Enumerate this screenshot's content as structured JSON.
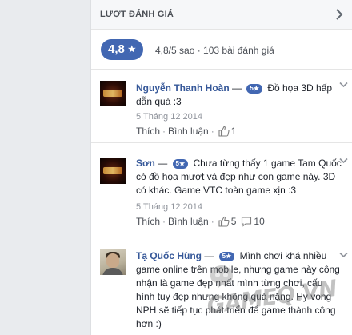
{
  "header": {
    "title": "LƯỢT ĐÁNH GIÁ"
  },
  "summary": {
    "rating": "4,8",
    "rating_text": "4,8/5 sao · 103 bài đánh giá"
  },
  "reviews": [
    {
      "author": "Nguyễn Thanh Hoàn",
      "dash": " — ",
      "stars_badge": "5★",
      "text": "Đồ họa 3D hấp dẫn quá :3",
      "date": "5 Tháng 12 2014",
      "like_label": "Thích",
      "comment_label": "Bình luận",
      "like_count": "1"
    },
    {
      "author": "Sơn",
      "dash": " — ",
      "stars_badge": "5★",
      "text": "Chưa từng thấy 1 game Tam Quốc có đồ họa mượt và đẹp như con game này. 3D có khác. Game VTC toàn game xịn :3",
      "date": "5 Tháng 12 2014",
      "like_label": "Thích",
      "comment_label": "Bình luận",
      "like_count": "5",
      "comment_count": "10"
    },
    {
      "author": "Tạ Quốc Hùng",
      "dash": " — ",
      "stars_badge": "5★",
      "text": "Mình chơi khá nhiều game online trên mobile, nhưng game này công nhận là game đẹp nhất mình từng chơi, cấu hình tuy đẹp nhưng không quá nặng. Hy vọng NPH sẽ tiếp tục phát triển để game thành công hơn :)"
    }
  ],
  "watermark": "GAMEQ.VN",
  "colors": {
    "accent": "#4267b2",
    "link": "#365899",
    "muted": "#90949c"
  }
}
